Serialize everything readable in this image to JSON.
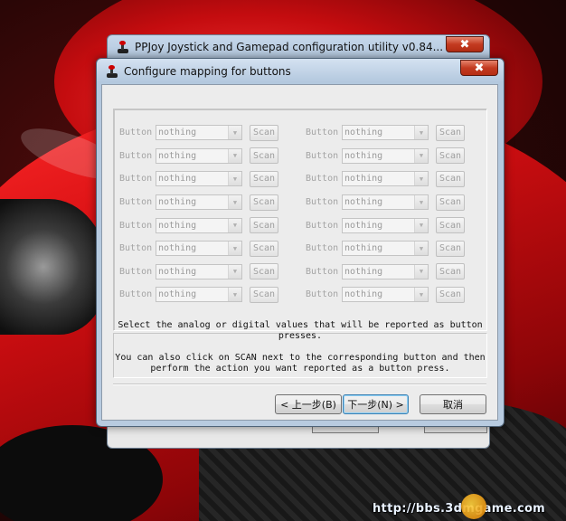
{
  "back_window": {
    "title": "PPJoy Joystick and Gamepad configuration utility   v0.84...",
    "close_label": "✖"
  },
  "dialog": {
    "title": "Configure mapping for buttons",
    "close_label": "✖",
    "mapping_rows": {
      "left": [
        {
          "label": "Button",
          "value": "nothing",
          "scan": "Scan"
        },
        {
          "label": "Button",
          "value": "nothing",
          "scan": "Scan"
        },
        {
          "label": "Button",
          "value": "nothing",
          "scan": "Scan"
        },
        {
          "label": "Button",
          "value": "nothing",
          "scan": "Scan"
        },
        {
          "label": "Button",
          "value": "nothing",
          "scan": "Scan"
        },
        {
          "label": "Button",
          "value": "nothing",
          "scan": "Scan"
        },
        {
          "label": "Button",
          "value": "nothing",
          "scan": "Scan"
        },
        {
          "label": "Button",
          "value": "nothing",
          "scan": "Scan"
        }
      ],
      "right": [
        {
          "label": "Button",
          "value": "nothing",
          "scan": "Scan"
        },
        {
          "label": "Button",
          "value": "nothing",
          "scan": "Scan"
        },
        {
          "label": "Button",
          "value": "nothing",
          "scan": "Scan"
        },
        {
          "label": "Button",
          "value": "nothing",
          "scan": "Scan"
        },
        {
          "label": "Button",
          "value": "nothing",
          "scan": "Scan"
        },
        {
          "label": "Button",
          "value": "nothing",
          "scan": "Scan"
        },
        {
          "label": "Button",
          "value": "nothing",
          "scan": "Scan"
        },
        {
          "label": "Button",
          "value": "nothing",
          "scan": "Scan"
        }
      ]
    },
    "description": {
      "line1": "Select the analog or digital values that will be reported as button presses.",
      "line2": "You can also click on SCAN next to the corresponding button and then perform the action you want reported as a button press."
    },
    "buttons": {
      "back": "< 上一步(B)",
      "next": "下一步(N) >",
      "cancel": "取消"
    }
  },
  "watermark": {
    "text": "http://bbs.3dmgame.com"
  }
}
